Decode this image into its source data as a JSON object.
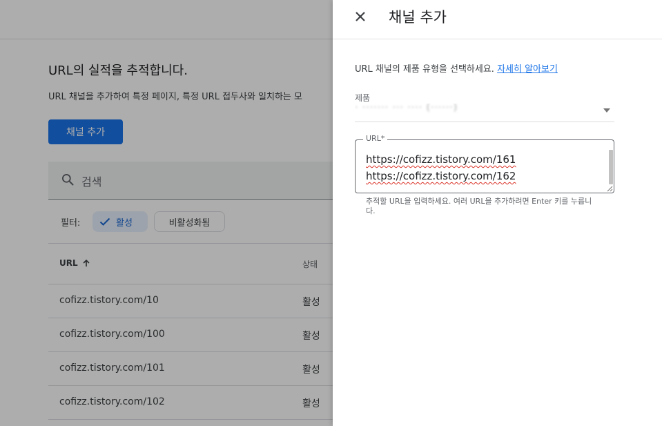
{
  "background": {
    "heading": "URL의 실적을 추적합니다.",
    "description": "URL 채널을 추가하여 특정 페이지, 특정 URL 접두사와 일치하는 모",
    "add_channel_button": "채널 추가",
    "search_placeholder": "검색",
    "filter_label": "필터:",
    "filter_chips": [
      "활성",
      "비활성화됨"
    ],
    "table": {
      "columns": [
        "URL",
        "상태"
      ],
      "rows": [
        {
          "url": "cofizz.tistory.com/10",
          "status": "활성"
        },
        {
          "url": "cofizz.tistory.com/100",
          "status": "활성"
        },
        {
          "url": "cofizz.tistory.com/101",
          "status": "활성"
        },
        {
          "url": "cofizz.tistory.com/102",
          "status": "활성"
        }
      ]
    }
  },
  "panel": {
    "title": "채널 추가",
    "intro": "URL 채널의 제품 유형을 선택하세요.",
    "learn_more": "자세히 알아보기",
    "product_label": "제품",
    "product_value": "·  ·······  ···  ····  (······)",
    "url_label": "URL*",
    "url_lines": [
      "https://cofizz.tistory.com/161",
      "https://cofizz.tistory.com/162"
    ],
    "url_help": "추적할 URL을 입력하세요. 여러 URL을 추가하려면 Enter 키를 누릅니다."
  },
  "colors": {
    "primary": "#1a73e8",
    "chip_active_bg": "#e8f0fe",
    "spellcheck": "#d93025"
  },
  "icons": [
    "close-icon",
    "search-icon",
    "check-icon",
    "arrow-up-icon",
    "chevron-down-icon"
  ]
}
